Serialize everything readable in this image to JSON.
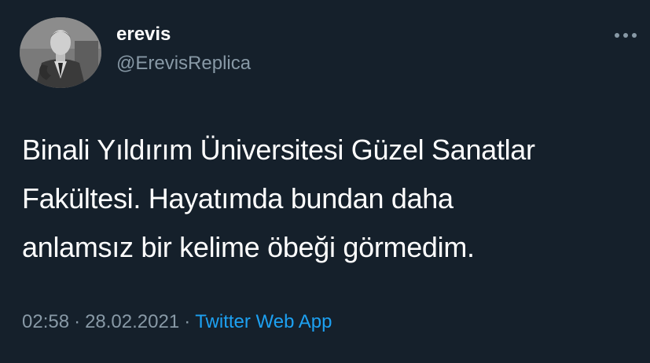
{
  "user": {
    "display_name": "erevis",
    "handle": "@ErevisReplica"
  },
  "more_icon": "more-horizontal-icon",
  "tweet": {
    "lines": [
      "Binali Yıldırım Üniversitesi Güzel Sanatlar",
      "Fakültesi. Hayatımda bundan daha",
      "anlamsız bir kelime öbeği görmedim."
    ]
  },
  "meta": {
    "time": "02:58",
    "separator": "·",
    "date": "28.02.2021",
    "source": "Twitter Web App"
  },
  "colors": {
    "background": "#15202b",
    "text": "#ffffff",
    "secondary": "#8899a6",
    "link": "#1da1f2"
  }
}
